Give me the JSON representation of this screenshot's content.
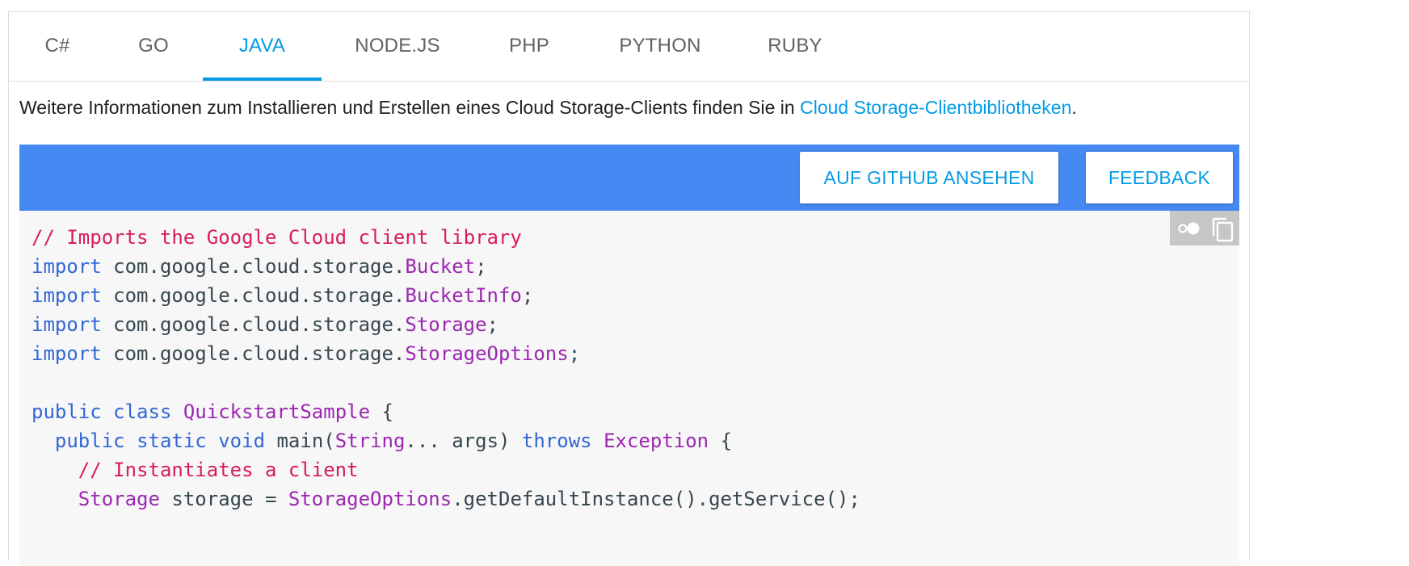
{
  "tabs": [
    {
      "label": "C#"
    },
    {
      "label": "GO"
    },
    {
      "label": "JAVA"
    },
    {
      "label": "NODE.JS"
    },
    {
      "label": "PHP"
    },
    {
      "label": "PYTHON"
    },
    {
      "label": "RUBY"
    }
  ],
  "active_tab": "JAVA",
  "intro": {
    "text": "Weitere Informationen zum Installieren und Erstellen eines Cloud Storage-Clients finden Sie in ",
    "link_text": "Cloud Storage-Clientbibliotheken",
    "suffix": "."
  },
  "toolbar": {
    "github_label": "AUF GITHUB ANSEHEN",
    "feedback_label": "FEEDBACK"
  },
  "code_tools": {
    "toggle_icon": "dark-theme-toggle-icon",
    "copy_icon": "copy-icon"
  },
  "colors": {
    "accent": "#039be5",
    "toolbar_bg": "#4688f1",
    "code_bg": "#f7f7f7",
    "comment": "#d81b60",
    "keyword": "#3367d6",
    "type": "#9c27b0",
    "plain": "#37474f"
  },
  "code": {
    "l1": {
      "comment": "// Imports the Google Cloud client library"
    },
    "l2": {
      "kw": "import",
      "plain": " com.google.cloud.storage.",
      "type": "Bucket",
      "end": ";"
    },
    "l3": {
      "kw": "import",
      "plain": " com.google.cloud.storage.",
      "type": "BucketInfo",
      "end": ";"
    },
    "l4": {
      "kw": "import",
      "plain": " com.google.cloud.storage.",
      "type": "Storage",
      "end": ";"
    },
    "l5": {
      "kw": "import",
      "plain": " com.google.cloud.storage.",
      "type": "StorageOptions",
      "end": ";"
    },
    "l7": {
      "kw1": "public",
      "kw2": "class",
      "type": "QuickstartSample",
      "end": " {"
    },
    "l8": {
      "kw1": "public",
      "kw2": "static",
      "kw3": "void",
      "name": " main(",
      "type1": "String",
      "mid": "... args) ",
      "kw4": "throws",
      "type2": "Exception",
      "end": " {"
    },
    "l9": {
      "comment": "// Instantiates a client"
    },
    "l10": {
      "type1": "Storage",
      "plain1": " storage = ",
      "type2": "StorageOptions",
      "plain2": ".getDefaultInstance().getService();"
    }
  }
}
